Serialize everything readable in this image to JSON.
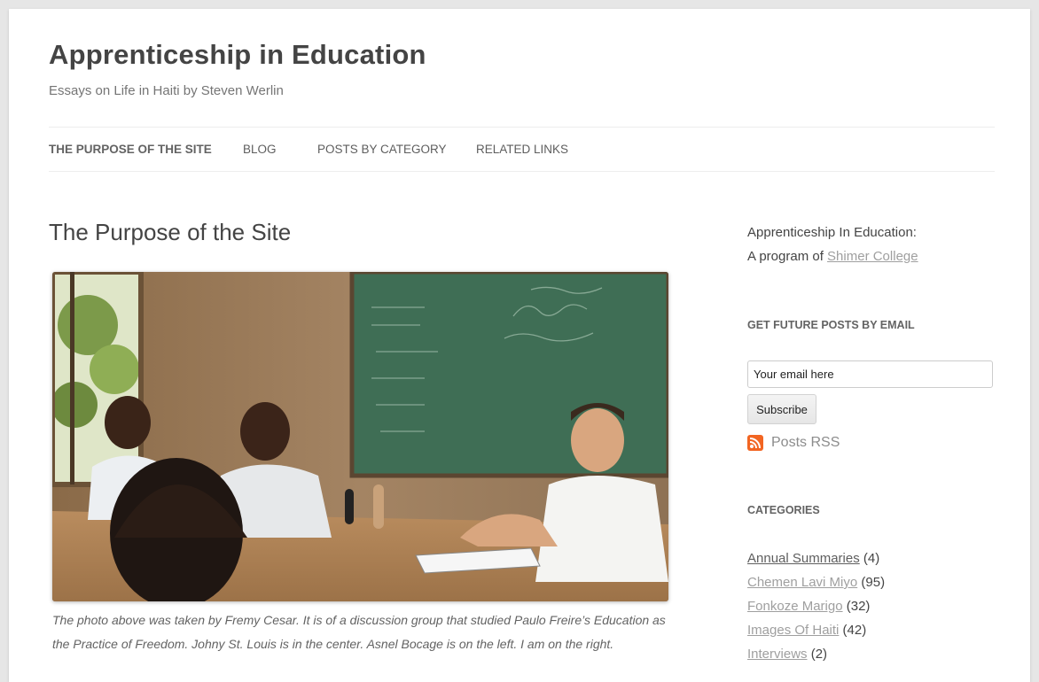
{
  "site": {
    "title": "Apprenticeship in Education",
    "description": "Essays on Life in Haiti by Steven Werlin"
  },
  "nav": {
    "items": [
      {
        "label": "THE PURPOSE OF THE SITE"
      },
      {
        "label": "BLOG"
      },
      {
        "label": "POSTS BY CATEGORY"
      },
      {
        "label": "RELATED LINKS"
      }
    ]
  },
  "main": {
    "title": "The Purpose of the Site",
    "photo_alt": "Discussion group photo",
    "caption": "The photo above was taken by Fremy Cesar. It is of a discussion group that studied Paulo Freire’s Education as the Practice of Freedom. Johny St. Louis is in the center. Asnel Bocage is on the left. I am on the right."
  },
  "sidebar": {
    "intro_line1": "Apprenticeship In Education:",
    "intro_line2_prefix": "A program of ",
    "intro_link": "Shimer College",
    "email_widget_title": "GET FUTURE POSTS BY EMAIL",
    "email_placeholder": "Your email here",
    "subscribe_label": "Subscribe",
    "rss_label": "Posts RSS",
    "categories_title": "CATEGORIES",
    "categories": [
      {
        "name": "Annual Summaries",
        "count": "(4)"
      },
      {
        "name": "Chemen Lavi Miyo",
        "count": "(95)"
      },
      {
        "name": "Fonkoze Marigo",
        "count": "(32)"
      },
      {
        "name": "Images Of Haiti",
        "count": "(42)"
      },
      {
        "name": "Interviews",
        "count": "(2)"
      }
    ]
  },
  "colors": {
    "rss_orange": "#f26522",
    "chalkboard_green": "#3f6e55",
    "link_gray": "#9f9f9f"
  }
}
